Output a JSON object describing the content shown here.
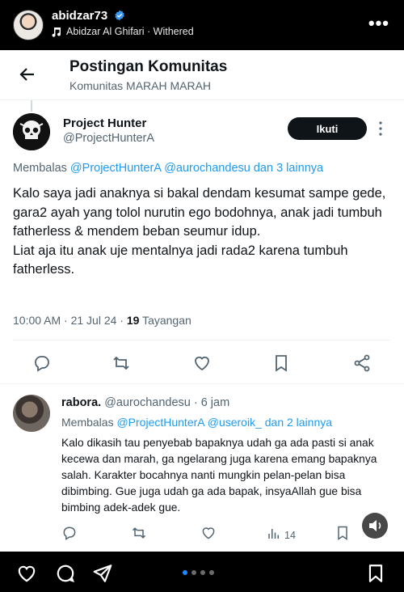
{
  "instagram": {
    "username": "abidzar73",
    "music": "Abidzar Al Ghifari · Withered",
    "carousel": {
      "count": 4,
      "active_index": 0
    }
  },
  "x_header": {
    "title": "Postingan Komunitas",
    "subtitle": "Komunitas MARAH MARAH"
  },
  "main_post": {
    "display_name": "Project Hunter",
    "handle": "@ProjectHunterA",
    "follow_label": "Ikuti",
    "reply_prefix": "Membalas ",
    "reply_targets": "@ProjectHunterA @aurochandesu dan 3 lainnya",
    "text": "Kalo saya jadi anaknya si bakal dendam kesumat sampe gede, gara2 ayah yang tolol nurutin ego bodohnya, anak jadi tumbuh fatherless & mendem beban seumur idup.\nLiat aja itu anak uje mentalnya jadi rada2 karena tumbuh fatherless.",
    "timestamp": "10:00 AM · 21 Jul 24 · ",
    "views_count": "19",
    "views_label": " Tayangan"
  },
  "reply_post": {
    "display_name": "rabora.",
    "handle_time": " @aurochandesu · 6 jam",
    "reply_prefix": "Membalas ",
    "reply_targets": "@ProjectHunterA @useroik_ dan 2 lainnya",
    "text": "Kalo dikasih tau penyebab bapaknya udah ga ada pasti si anak kecewa dan marah, ga ngelarang juga karena emang bapaknya salah. Karakter bocahnya nanti mungkin pelan-pelan bisa dibimbing. Gue juga udah ga ada bapak, insyaAllah gue bisa bimbing adek-adek gue.",
    "views": "14"
  },
  "colors": {
    "x_link": "#1d9bf0",
    "x_text": "#0f1419",
    "x_secondary": "#536471",
    "ig_dot_active": "#1e88ff"
  },
  "icons": [
    "verified-badge-icon",
    "music-note-icon",
    "more-icon",
    "back-arrow-icon",
    "kebab-icon",
    "reply-icon",
    "retweet-icon",
    "like-icon",
    "bookmark-icon",
    "share-icon",
    "views-icon",
    "sound-icon",
    "heart-icon",
    "comment-icon",
    "send-icon",
    "save-icon"
  ]
}
